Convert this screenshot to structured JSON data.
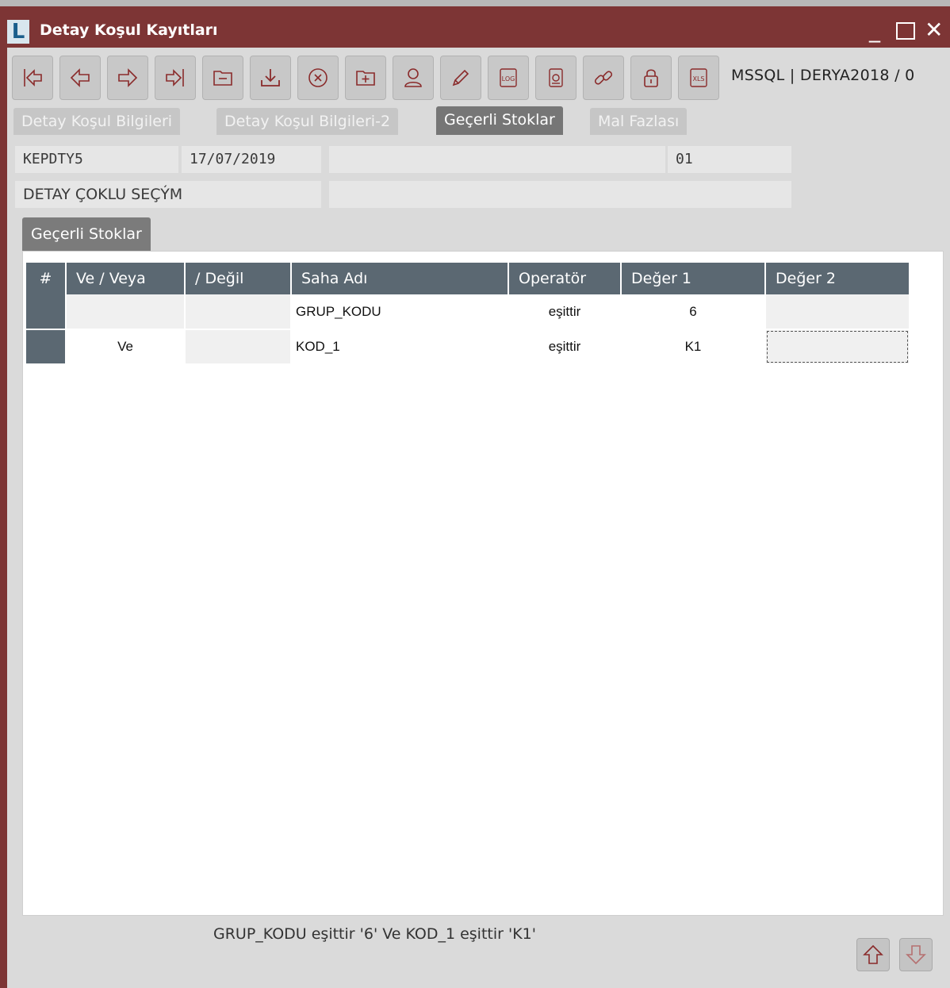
{
  "window": {
    "title": "Detay Koşul Kayıtları",
    "logo_letter": "L",
    "minimize_glyph": "_",
    "close_glyph": "✕"
  },
  "toolbar": {
    "buttons": [
      {
        "icon": "first-record-icon"
      },
      {
        "icon": "previous-record-icon"
      },
      {
        "icon": "next-record-icon"
      },
      {
        "icon": "last-record-icon"
      },
      {
        "icon": "delete-record-icon"
      },
      {
        "icon": "save-icon"
      },
      {
        "icon": "cancel-icon"
      },
      {
        "icon": "new-record-icon"
      },
      {
        "icon": "user-icon"
      },
      {
        "icon": "edit-pencil-icon"
      },
      {
        "icon": "log-icon"
      },
      {
        "icon": "document-icon"
      },
      {
        "icon": "link-icon"
      },
      {
        "icon": "lock-icon"
      },
      {
        "icon": "xls-export-icon"
      }
    ],
    "db_label": "MSSQL | DERYA2018 / 0",
    "icon_color": "#8a2b2b"
  },
  "tabs": [
    {
      "label": "Detay Koşul Bilgileri",
      "active": false
    },
    {
      "label": "Detay Koşul Bilgileri-2",
      "active": false
    },
    {
      "label": "Geçerli Stoklar",
      "active": true
    },
    {
      "label": "Mal Fazlası",
      "active": false
    }
  ],
  "form": {
    "code": "KEPDTY5",
    "date": "17/07/2019",
    "desc": "",
    "branch": "01",
    "label": "DETAY ÇOKLU SEÇÝM",
    "label_value": ""
  },
  "sub_tab": {
    "label": "Geçerli Stoklar"
  },
  "grid": {
    "headers": {
      "num": "#",
      "and_or": "Ve / Veya",
      "not": "/ Değil",
      "field_name": "Saha Adı",
      "operator": "Operatör",
      "value1": "Değer 1",
      "value2": "Değer 2"
    },
    "rows": [
      {
        "and_or": "",
        "not": "",
        "field_name": "GRUP_KODU",
        "operator": "eşittir",
        "value1": "6",
        "value2": ""
      },
      {
        "and_or": "Ve",
        "not": "",
        "field_name": "KOD_1",
        "operator": "eşittir",
        "value1": "K1",
        "value2": ""
      }
    ]
  },
  "status": {
    "summary": "GRUP_KODU eşittir '6' Ve KOD_1 eşittir 'K1'"
  },
  "colors": {
    "titlebar": "#7d3535",
    "grid_header": "#5b6872",
    "active_tab": "#767676"
  }
}
